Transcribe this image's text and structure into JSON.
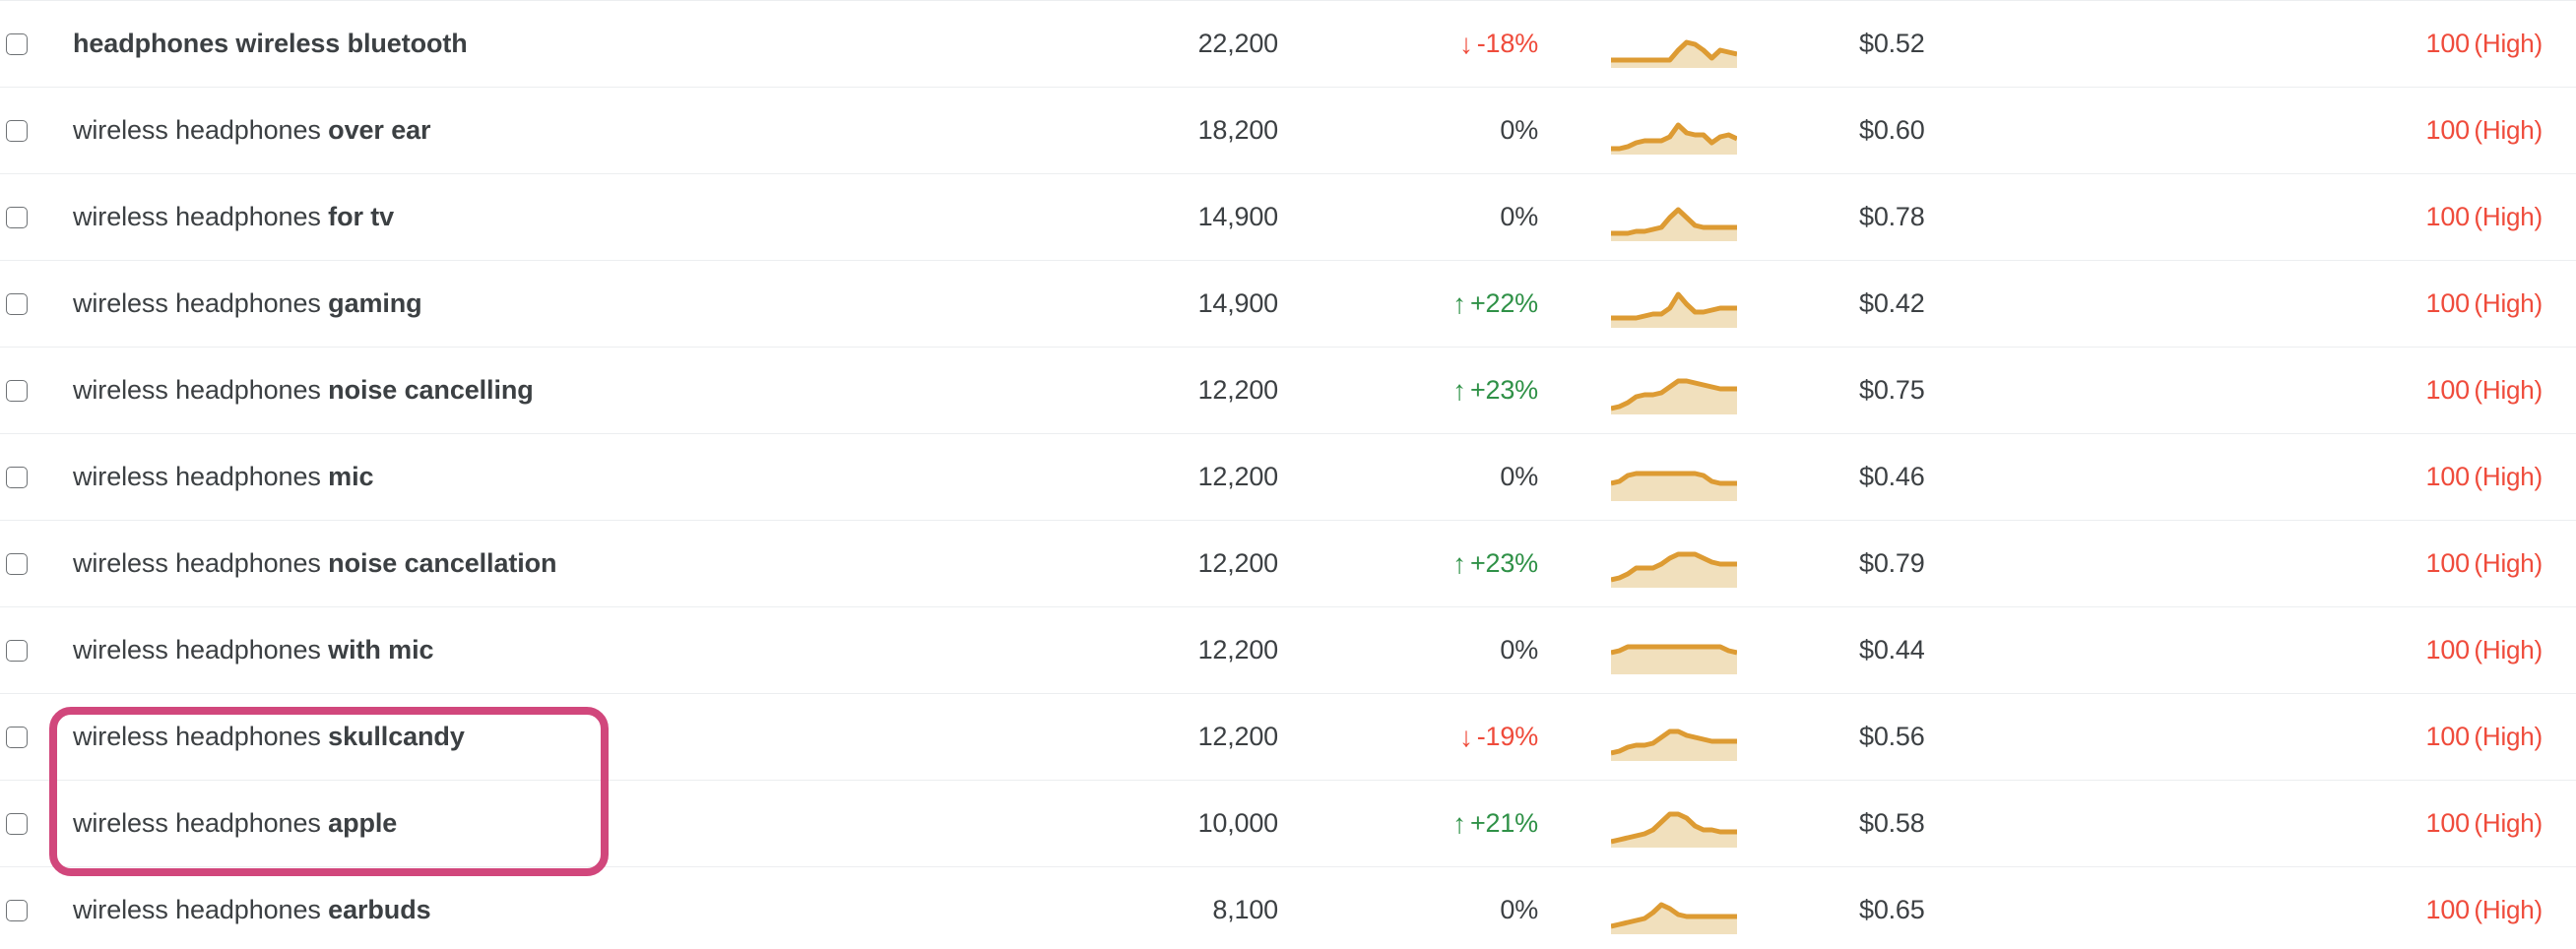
{
  "theme": {
    "row_divider": "#eceef0",
    "text_primary": "#3c4043",
    "trend_up_color": "#2f9147",
    "trend_down_color": "#ef4b3b",
    "kd_high_color": "#ef4b3b",
    "spark_stroke": "#dd9b33",
    "spark_fill": "#f1e0bd",
    "annotation_color": "#d1477c",
    "checkbox_border": "#6e7275"
  },
  "icons": {
    "checkbox": "checkbox-unchecked-icon",
    "arrow_up": "arrow-up-icon",
    "arrow_down": "arrow-down-icon",
    "sparkline": "sparkline-chart-icon"
  },
  "glyphs": {
    "arrow_up": "↑",
    "arrow_down": "↓"
  },
  "annotation": {
    "name": "highlight-box",
    "target_rows": [
      9,
      10
    ],
    "color": "#d1477c",
    "shape": "rounded-rectangle"
  },
  "table": {
    "columns": [
      "keyword",
      "volume",
      "trend",
      "sparkline",
      "cpc",
      "keyword_difficulty"
    ],
    "rows": [
      {
        "keyword_base": "",
        "keyword_modifier": "headphones wireless bluetooth",
        "all_bold": true,
        "volume": "22,200",
        "trend": "-18%",
        "trend_direction": "down",
        "cpc": "$0.52",
        "kd_score": "100",
        "kd_label": "(High)",
        "spark": [
          40,
          40,
          40,
          40,
          40,
          40,
          40,
          40,
          30,
          22,
          24,
          30,
          38,
          30,
          32,
          34
        ]
      },
      {
        "keyword_base": "wireless headphones ",
        "keyword_modifier": "over ear",
        "all_bold": false,
        "volume": "18,200",
        "trend": "0%",
        "trend_direction": "flat",
        "cpc": "$0.60",
        "kd_score": "100",
        "kd_label": "(High)",
        "spark": [
          42,
          42,
          40,
          36,
          34,
          34,
          34,
          30,
          18,
          26,
          28,
          28,
          36,
          30,
          28,
          32
        ]
      },
      {
        "keyword_base": "wireless headphones ",
        "keyword_modifier": "for tv",
        "all_bold": false,
        "volume": "14,900",
        "trend": "0%",
        "trend_direction": "flat",
        "cpc": "$0.78",
        "kd_score": "100",
        "kd_label": "(High)",
        "spark": [
          40,
          40,
          40,
          38,
          38,
          36,
          34,
          24,
          16,
          24,
          32,
          34,
          34,
          34,
          34,
          34
        ]
      },
      {
        "keyword_base": "wireless headphones ",
        "keyword_modifier": "gaming",
        "all_bold": false,
        "volume": "14,900",
        "trend": "+22%",
        "trend_direction": "up",
        "cpc": "$0.42",
        "kd_score": "100",
        "kd_label": "(High)",
        "spark": [
          38,
          38,
          38,
          38,
          36,
          34,
          34,
          28,
          14,
          24,
          32,
          32,
          30,
          28,
          28,
          28
        ]
      },
      {
        "keyword_base": "wireless headphones ",
        "keyword_modifier": "noise cancelling",
        "all_bold": false,
        "volume": "12,200",
        "trend": "+23%",
        "trend_direction": "up",
        "cpc": "$0.75",
        "kd_score": "100",
        "kd_label": "(High)",
        "spark": [
          42,
          40,
          36,
          30,
          28,
          28,
          26,
          20,
          14,
          14,
          16,
          18,
          20,
          22,
          22,
          22
        ]
      },
      {
        "keyword_base": "wireless headphones ",
        "keyword_modifier": "mic",
        "all_bold": false,
        "volume": "12,200",
        "trend": "0%",
        "trend_direction": "flat",
        "cpc": "$0.46",
        "kd_score": "100",
        "kd_label": "(High)",
        "spark": [
          30,
          28,
          22,
          20,
          20,
          20,
          20,
          20,
          20,
          20,
          20,
          22,
          28,
          30,
          30,
          30
        ]
      },
      {
        "keyword_base": "wireless headphones ",
        "keyword_modifier": "noise cancellation",
        "all_bold": false,
        "volume": "12,200",
        "trend": "+23%",
        "trend_direction": "up",
        "cpc": "$0.79",
        "kd_score": "100",
        "kd_label": "(High)",
        "spark": [
          40,
          38,
          34,
          28,
          28,
          28,
          24,
          18,
          14,
          14,
          14,
          18,
          22,
          24,
          24,
          24
        ]
      },
      {
        "keyword_base": "wireless headphones ",
        "keyword_modifier": "with mic",
        "all_bold": false,
        "volume": "12,200",
        "trend": "0%",
        "trend_direction": "flat",
        "cpc": "$0.44",
        "kd_score": "100",
        "kd_label": "(High)",
        "spark": [
          26,
          24,
          20,
          20,
          20,
          20,
          20,
          20,
          20,
          20,
          20,
          20,
          20,
          20,
          24,
          26
        ]
      },
      {
        "keyword_base": "wireless headphones ",
        "keyword_modifier": "skullcandy",
        "all_bold": false,
        "volume": "12,200",
        "trend": "-19%",
        "trend_direction": "down",
        "cpc": "$0.56",
        "kd_score": "100",
        "kd_label": "(High)",
        "spark": [
          40,
          38,
          34,
          32,
          32,
          30,
          24,
          18,
          18,
          22,
          24,
          26,
          28,
          28,
          28,
          28
        ]
      },
      {
        "keyword_base": "wireless headphones ",
        "keyword_modifier": "apple",
        "all_bold": false,
        "volume": "10,000",
        "trend": "+21%",
        "trend_direction": "up",
        "cpc": "$0.58",
        "kd_score": "100",
        "kd_label": "(High)",
        "spark": [
          42,
          40,
          38,
          36,
          34,
          30,
          22,
          14,
          14,
          18,
          26,
          30,
          30,
          32,
          32,
          32
        ]
      },
      {
        "keyword_base": "wireless headphones ",
        "keyword_modifier": "earbuds",
        "all_bold": false,
        "volume": "8,100",
        "trend": "0%",
        "trend_direction": "flat",
        "cpc": "$0.65",
        "kd_score": "100",
        "kd_label": "(High)",
        "spark": [
          40,
          38,
          36,
          34,
          32,
          26,
          18,
          22,
          28,
          30,
          30,
          30,
          30,
          30,
          30,
          30
        ]
      }
    ]
  }
}
